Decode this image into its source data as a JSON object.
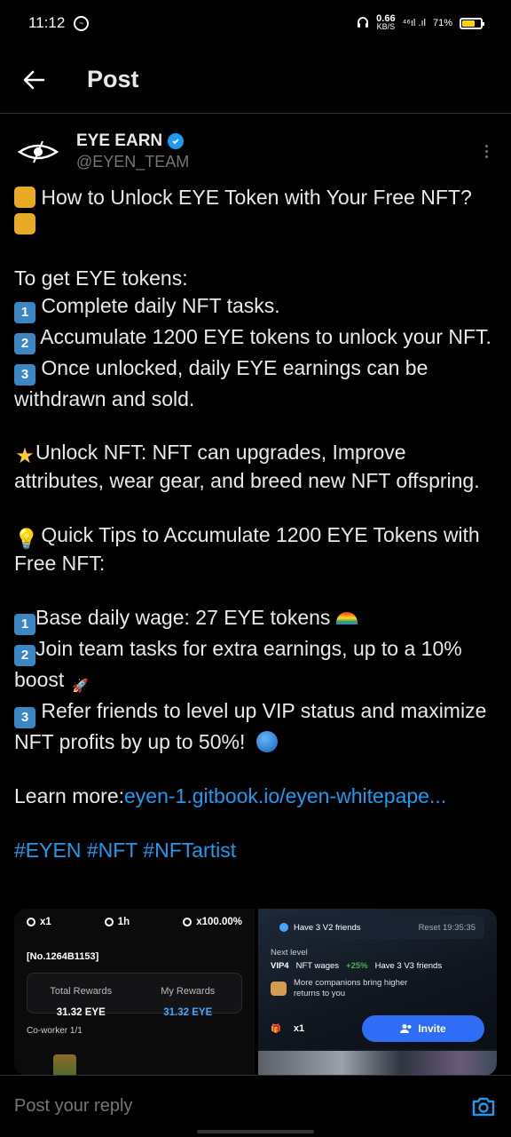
{
  "status_bar": {
    "time": "11:12",
    "net_speed": "0.66",
    "net_unit": "KB/S",
    "signal": "⁴⁶ıl .ıl",
    "battery": "71%"
  },
  "header": {
    "title": "Post"
  },
  "post": {
    "author_name": "EYE EARN",
    "author_handle": "@EYEN_TEAM",
    "title_line": " How to Unlock EYE Token with Your Free NFT?",
    "intro": "To get EYE tokens:",
    "steps": [
      " Complete daily NFT tasks.",
      " Accumulate 1200 EYE tokens to unlock your NFT.",
      " Once unlocked, daily EYE earnings can be withdrawn and sold."
    ],
    "unlock_text": "Unlock NFT: NFT can upgrades, Improve attributes, wear gear, and breed new NFT offspring.",
    "tips_title": " Quick Tips to Accumulate 1200 EYE Tokens with Free NFT:",
    "tips": [
      "Base daily wage: 27 EYE tokens ",
      "Join team tasks for extra earnings, up to a 10% boost ",
      " Refer friends to level up VIP status and maximize NFT profits by up to 50%! "
    ],
    "learn_more_label": "Learn more:",
    "learn_more_link": "eyen-1.gitbook.io/eyen-whitepape...",
    "hashtags": "#EYEN #NFT #NFTartist"
  },
  "media": {
    "left": {
      "stat1": "x1",
      "stat2": "1h",
      "stat3": "x100.00%",
      "nft_id": "[No.1264B1153]",
      "total_rewards_label": "Total Rewards",
      "total_rewards_value": "31.32 EYE",
      "my_rewards_label": "My Rewards",
      "my_rewards_value": "31.32 EYE",
      "coworker": "Co-worker 1/1"
    },
    "right": {
      "friends": "Have 3 V2 friends",
      "reset": "Reset 19:35:35",
      "next_level": "Next level",
      "vip": "VIP4",
      "wages": "NFT wages",
      "wages_boost": "+25%",
      "req": "Have 3 V3 friends",
      "companions": "More companions bring higher returns to you",
      "count": "x1",
      "invite": "Invite"
    }
  },
  "reply": {
    "placeholder": "Post your reply"
  }
}
